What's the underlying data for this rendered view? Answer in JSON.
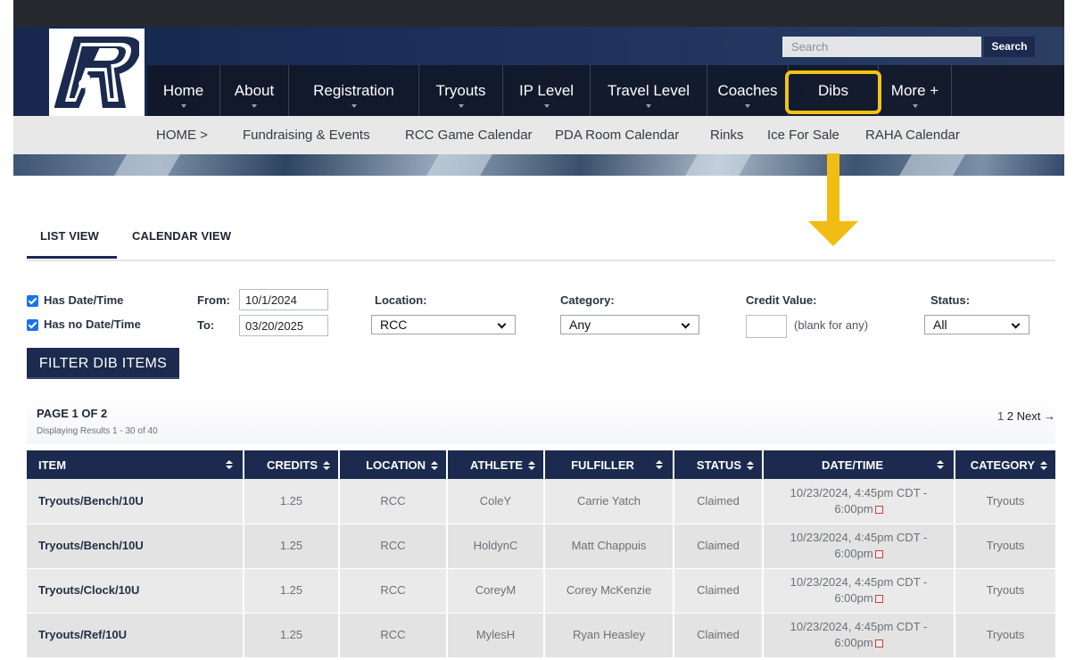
{
  "header": {
    "search": {
      "placeholder": "Search",
      "button_label": "Search"
    },
    "nav": [
      {
        "label": "Home"
      },
      {
        "label": "About"
      },
      {
        "label": "Registration"
      },
      {
        "label": "Tryouts"
      },
      {
        "label": "IP Level"
      },
      {
        "label": "Travel Level"
      },
      {
        "label": "Coaches"
      },
      {
        "label": "Dibs"
      },
      {
        "label": "More +"
      }
    ],
    "subnav": [
      "HOME  >",
      "Fundraising & Events",
      "RCC Game Calendar",
      "PDA Room Calendar",
      "Rinks",
      "Ice For Sale",
      "RAHA Calendar"
    ],
    "highlight_color": "#f5c114"
  },
  "tabs": {
    "list_view": "LIST VIEW",
    "calendar_view": "CALENDAR VIEW"
  },
  "filters": {
    "has_date_time": "Has Date/Time",
    "has_no_date_time": "Has no Date/Time",
    "from_label": "From:",
    "from_value": "10/1/2024",
    "to_label": "To:",
    "to_value": "03/20/2025",
    "location_label": "Location:",
    "location_value": "RCC",
    "category_label": "Category:",
    "category_value": "Any",
    "credit_label": "Credit Value:",
    "credit_hint": "(blank for any)",
    "status_label": "Status:",
    "status_value": "All",
    "filter_button": "FILTER DIB ITEMS"
  },
  "pager": {
    "page_of": "PAGE 1 OF 2",
    "displaying": "Displaying Results 1 - 30 of 40",
    "page1": "1",
    "page2": "2",
    "next": "Next →"
  },
  "table": {
    "columns": [
      "ITEM",
      "CREDITS",
      "LOCATION",
      "ATHLETE",
      "FULFILLER",
      "STATUS",
      "DATE/TIME",
      "CATEGORY"
    ],
    "rows": [
      {
        "item": "Tryouts/Bench/10U",
        "credits": "1.25",
        "location": "RCC",
        "athlete": "ColeY",
        "fulfiller": "Carrie Yatch",
        "status": "Claimed",
        "date_line1": "10/23/2024, 4:45pm CDT -",
        "date_line2": "6:00pm",
        "category": "Tryouts"
      },
      {
        "item": "Tryouts/Bench/10U",
        "credits": "1.25",
        "location": "RCC",
        "athlete": "HoldynC",
        "fulfiller": "Matt Chappuis",
        "status": "Claimed",
        "date_line1": "10/23/2024, 4:45pm CDT -",
        "date_line2": "6:00pm",
        "category": "Tryouts"
      },
      {
        "item": "Tryouts/Clock/10U",
        "credits": "1.25",
        "location": "RCC",
        "athlete": "CoreyM",
        "fulfiller": "Corey McKenzie",
        "status": "Claimed",
        "date_line1": "10/23/2024, 4:45pm CDT -",
        "date_line2": "6:00pm",
        "category": "Tryouts"
      },
      {
        "item": "Tryouts/Ref/10U",
        "credits": "1.25",
        "location": "RCC",
        "athlete": "MylesH",
        "fulfiller": "Ryan Heasley",
        "status": "Claimed",
        "date_line1": "10/23/2024, 4:45pm CDT -",
        "date_line2": "6:00pm",
        "category": "Tryouts"
      }
    ]
  }
}
